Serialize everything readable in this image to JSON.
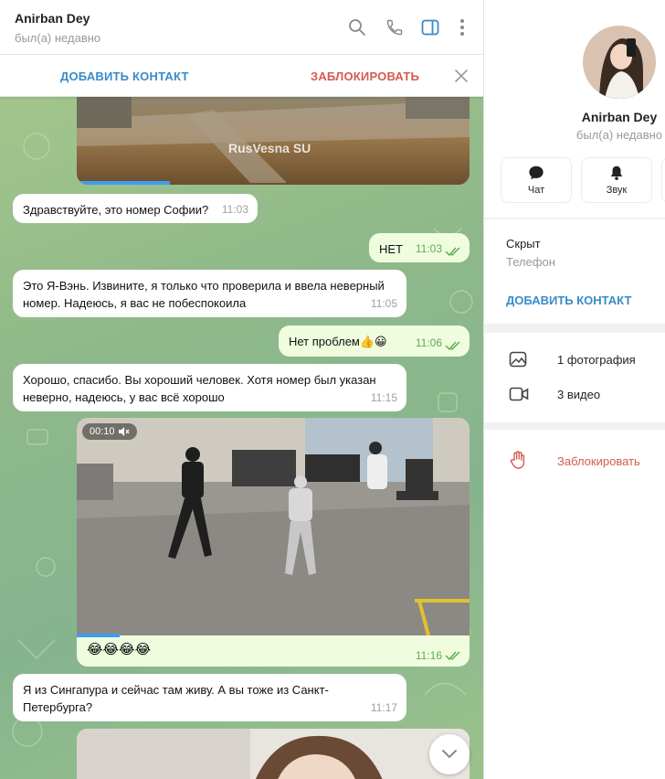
{
  "chat": {
    "name": "Anirban Dey",
    "status": "был(а) недавно",
    "add_contact": "ДОБАВИТЬ КОНТАКТ",
    "block": "ЗАБЛОКИРОВАТЬ",
    "video_watermark": "RusVesna SU",
    "video_duration": "00:10",
    "messages": [
      {
        "text": "Здравствуйте, это номер Софии?",
        "time": "11:03"
      },
      {
        "text": "НЕТ",
        "time": "11:03"
      },
      {
        "text": "Это Я-Вэнь. Извините, я только что проверила и ввела неверный номер. Надеюсь, я вас не побеспокоила",
        "time": "11:05"
      },
      {
        "text": "Нет проблем👍😀",
        "time": "11:06"
      },
      {
        "text": "Хорошо, спасибо. Вы хороший человек. Хотя номер был указан неверно, надеюсь, у вас всё хорошо",
        "time": "11:15"
      },
      {
        "text": "😂😂😂😂",
        "time": "11:16"
      },
      {
        "text": "Я из Сингапура и сейчас там живу. А вы тоже из Санкт-Петербурга?",
        "time": "11:17"
      }
    ]
  },
  "profile": {
    "name": "Anirban Dey",
    "status": "был(а) недавно",
    "buttons": [
      "Чат",
      "Звук"
    ],
    "hidden_label": "Скрыт",
    "phone_label": "Телефон",
    "add_contact": "ДОБАВИТЬ КОНТАКТ",
    "photos": "1 фотография",
    "videos": "3 видео",
    "block": "Заблокировать"
  },
  "colors": {
    "accent": "#3a8bc9",
    "danger": "#d45b4f",
    "outgoing": "#effdde",
    "read_ticks": "#62ac55"
  }
}
